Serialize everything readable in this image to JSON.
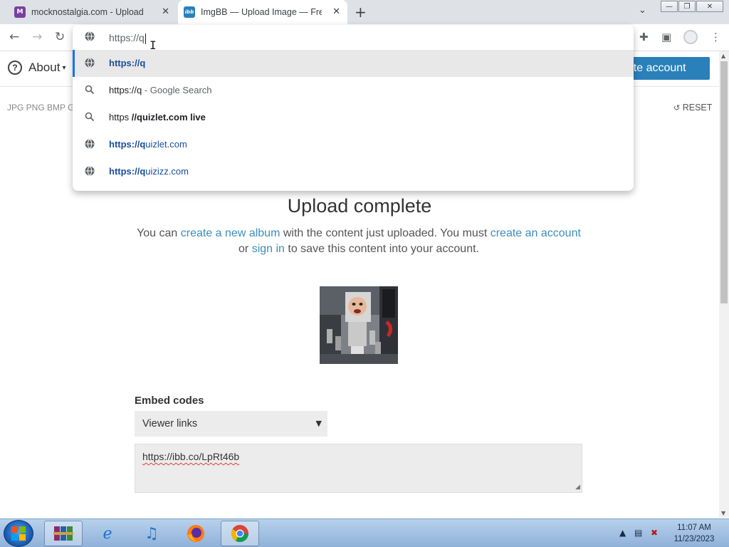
{
  "browser": {
    "tabs": [
      {
        "title": "mocknostalgia.com - Upload",
        "favicon": "M",
        "close": "✕"
      },
      {
        "title": "ImgBB — Upload Image — Free",
        "favicon": "ibb",
        "close": "✕"
      }
    ],
    "new_tab": "+",
    "tab_search": "⌄",
    "window_controls": {
      "minimize": "—",
      "restore": "❐",
      "close": "✕"
    },
    "nav": {
      "back": "←",
      "forward": "→",
      "reload": "↻"
    },
    "omnibox": {
      "text": "https://q",
      "suggestions": [
        {
          "type": "url",
          "parts": [
            {
              "t": "https://q",
              "style": "link bold"
            }
          ]
        },
        {
          "type": "search",
          "parts": [
            {
              "t": "https://q",
              "style": ""
            },
            {
              "t": " - Google Search",
              "style": "muted"
            }
          ]
        },
        {
          "type": "search",
          "parts": [
            {
              "t": "https ",
              "style": ""
            },
            {
              "t": "//q",
              "style": "bold"
            },
            {
              "t": "uizlet.com live",
              "style": "bold"
            }
          ]
        },
        {
          "type": "url",
          "parts": [
            {
              "t": "https://q",
              "style": "link bold"
            },
            {
              "t": "uizlet.com",
              "style": "link"
            }
          ]
        },
        {
          "type": "url",
          "parts": [
            {
              "t": "https://q",
              "style": "link bold"
            },
            {
              "t": "uizizz.com",
              "style": "link"
            }
          ]
        }
      ]
    }
  },
  "page": {
    "about_label": "About",
    "about_icon": "?",
    "create_account": "eate account",
    "formats": "JPG PNG BMP G",
    "reset": "RESET",
    "upload_title": "Upload complete",
    "msg": {
      "p1": "You can ",
      "link1": "create a new album",
      "p2": " with the content just uploaded. You must ",
      "link2": "create an account",
      "p3": " or ",
      "link3": "sign in",
      "p4": " to save this content into your account."
    },
    "embed_label": "Embed codes",
    "embed_select": "Viewer links",
    "embed_value": "https://ibb.co/LpRt46b"
  },
  "taskbar": {
    "clock_time": "11:07 AM",
    "clock_date": "11/23/2023"
  },
  "colors": {
    "accent": "#2a80b9",
    "link": "#3c8dbc",
    "omnibox_link": "#1a4e9b",
    "selection_bar": "#1a73e8"
  }
}
